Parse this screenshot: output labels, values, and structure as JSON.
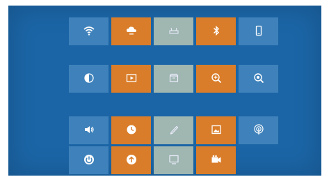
{
  "sections": [
    {
      "title": "",
      "tiles": [
        {
          "label": "",
          "color": "#3f82bb",
          "icon": "wifi-icon"
        },
        {
          "label": "",
          "color": "#d97d2a",
          "icon": "cloud-network-icon"
        },
        {
          "label": "",
          "color": "#9fb6b1",
          "icon": "router-icon"
        },
        {
          "label": "",
          "color": "#d97d2a",
          "icon": "bluetooth-icon"
        },
        {
          "label": "",
          "color": "#3f82bb",
          "icon": "phone-device-icon"
        }
      ]
    },
    {
      "title": "",
      "tiles": [
        {
          "label": "",
          "color": "#3f82bb",
          "icon": "display-half-icon"
        },
        {
          "label": "",
          "color": "#d97d2a",
          "icon": "video-play-icon"
        },
        {
          "label": "",
          "color": "#9fb6b1",
          "icon": "storage-box-icon"
        },
        {
          "label": "",
          "color": "#d97d2a",
          "icon": "zoom-in-icon"
        },
        {
          "label": "",
          "color": "#3f82bb",
          "icon": "magnifier-icon"
        }
      ]
    },
    {
      "title": "",
      "tiles": [
        {
          "label": "",
          "color": "#3f82bb",
          "icon": "speaker-icon"
        },
        {
          "label": "",
          "color": "#d97d2a",
          "icon": "clock-icon"
        },
        {
          "label": "",
          "color": "#9fb6b1",
          "icon": "pen-icon"
        },
        {
          "label": "",
          "color": "#d97d2a",
          "icon": "picture-frame-icon"
        },
        {
          "label": "",
          "color": "#3f82bb",
          "icon": "broadcast-icon"
        },
        {
          "label": "",
          "color": "#3f82bb",
          "icon": "power-icon"
        },
        {
          "label": "",
          "color": "#d97d2a",
          "icon": "upload-arrow-icon"
        },
        {
          "label": "",
          "color": "#9fb6b1",
          "icon": "monitor-icon"
        },
        {
          "label": "",
          "color": "#d97d2a",
          "icon": "video-camera-icon"
        }
      ]
    }
  ],
  "corner_text": ""
}
